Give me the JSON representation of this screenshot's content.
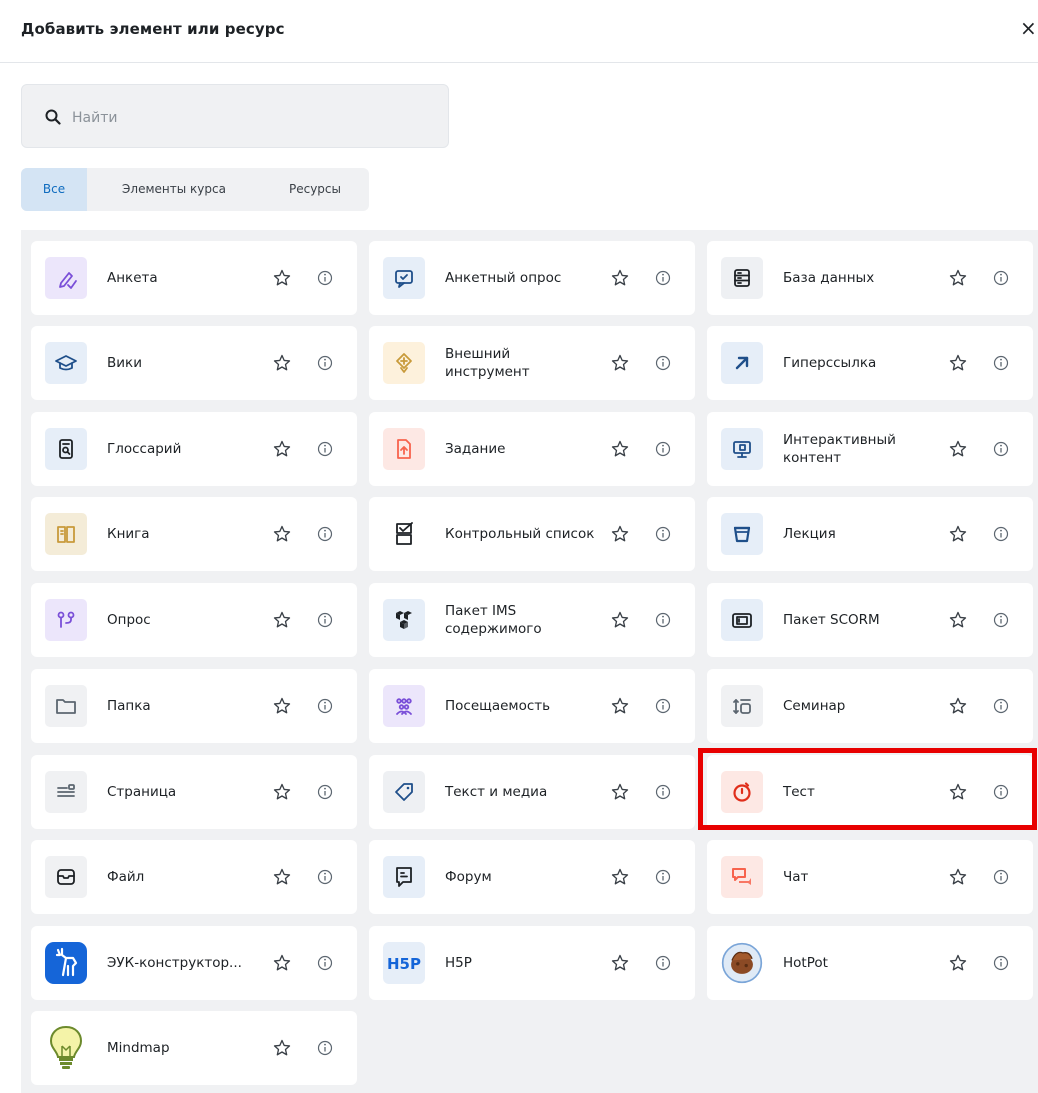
{
  "dialog": {
    "title": "Добавить элемент или ресурс",
    "close": "×"
  },
  "search": {
    "placeholder": "Найти"
  },
  "tabs": [
    {
      "label": "Все",
      "active": true
    },
    {
      "label": "Элементы курса",
      "active": false
    },
    {
      "label": "Ресурсы",
      "active": false
    }
  ],
  "items": [
    {
      "label": "Анкета",
      "icon": "pencil-check-icon"
    },
    {
      "label": "Анкетный опрос",
      "icon": "chat-check-icon"
    },
    {
      "label": "База данных",
      "icon": "database-icon"
    },
    {
      "label": "Вики",
      "icon": "graduation-cap-icon"
    },
    {
      "label": "Внешний инструмент",
      "icon": "puzzle-icon"
    },
    {
      "label": "Гиперссылка",
      "icon": "arrow-up-right-icon"
    },
    {
      "label": "Глоссарий",
      "icon": "glossary-icon"
    },
    {
      "label": "Задание",
      "icon": "file-upload-icon"
    },
    {
      "label": "Интерактивный контент",
      "icon": "monitor-icon"
    },
    {
      "label": "Книга",
      "icon": "book-icon"
    },
    {
      "label": "Контрольный список",
      "icon": "checklist-icon"
    },
    {
      "label": "Лекция",
      "icon": "lectern-icon"
    },
    {
      "label": "Опрос",
      "icon": "choice-icon"
    },
    {
      "label": "Пакет IMS содержимого",
      "icon": "boxes-icon"
    },
    {
      "label": "Пакет SCORM",
      "icon": "scorm-package-icon"
    },
    {
      "label": "Папка",
      "icon": "folder-icon"
    },
    {
      "label": "Посещаемость",
      "icon": "people-icon"
    },
    {
      "label": "Семинар",
      "icon": "workshop-icon"
    },
    {
      "label": "Страница",
      "icon": "page-icon"
    },
    {
      "label": "Текст и медиа",
      "icon": "tag-icon"
    },
    {
      "label": "Тест",
      "icon": "stopwatch-icon"
    },
    {
      "label": "Файл",
      "icon": "file-icon"
    },
    {
      "label": "Форум",
      "icon": "forum-icon"
    },
    {
      "label": "Чат",
      "icon": "chat-bubbles-icon"
    },
    {
      "label": "ЭУК-конструктор...",
      "icon": "deer-logo-icon"
    },
    {
      "label": "H5P",
      "icon": "h5p-logo-icon",
      "logo_text": "H5P"
    },
    {
      "label": "HotPot",
      "icon": "hotpot-logo-icon"
    },
    {
      "label": "Mindmap",
      "icon": "lightbulb-icon"
    }
  ],
  "colors": {
    "accent": "#0f6cbf",
    "highlight": "#e80000",
    "purple": "#7a4fd8",
    "orange": "#f7634d",
    "yellow": "#c89a3a"
  }
}
